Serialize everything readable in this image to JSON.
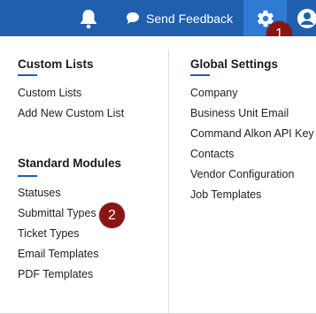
{
  "topbar": {
    "feedback_label": "Send Feedback",
    "icons": {
      "bell": "bell-icon",
      "chat": "chat-bubble-icon",
      "gear": "gear-icon",
      "user": "user-icon"
    },
    "colors": {
      "bar": "#1f5fae",
      "active_tile": "#2f7ad4"
    }
  },
  "menu": {
    "custom_lists": {
      "heading": "Custom Lists",
      "items": [
        "Custom Lists",
        "Add New Custom List"
      ]
    },
    "standard_modules": {
      "heading": "Standard Modules",
      "items": [
        "Statuses",
        "Submittal Types",
        "Ticket Types",
        "Email Templates",
        "PDF Templates"
      ]
    },
    "global_settings": {
      "heading": "Global Settings",
      "items": [
        "Company",
        "Business Unit Email",
        "Command Alkon API Key",
        "Contacts",
        "Vendor Configuration",
        "Job Templates"
      ]
    }
  },
  "callouts": [
    {
      "label": "1",
      "color": "#8b1414"
    },
    {
      "label": "2",
      "color": "#8b1414"
    }
  ]
}
